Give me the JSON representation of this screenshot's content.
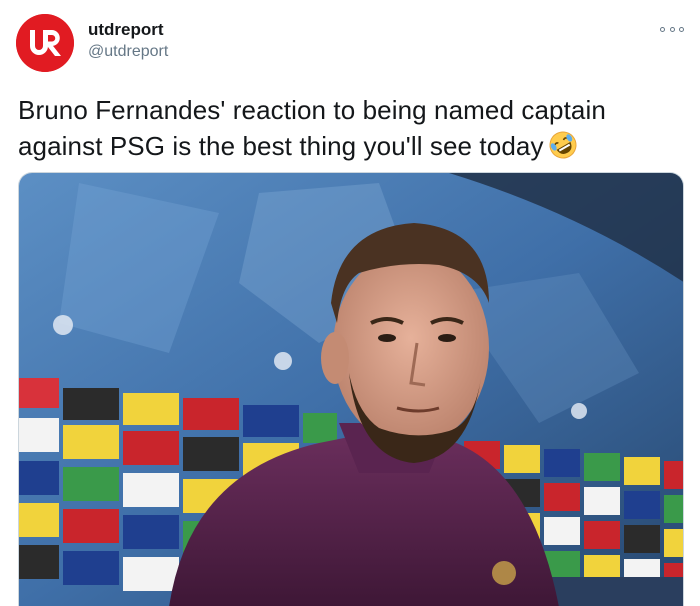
{
  "tweet": {
    "display_name": "utdreport",
    "handle": "@utdreport",
    "text": "Bruno Fernandes' reaction to being named captain against PSG is the best thing you'll see today",
    "emoji": "rolling-on-the-floor-laughing",
    "more_icon": "more-dots-icon"
  },
  "colors": {
    "brand_red": "#e11b22",
    "text": "#14171a",
    "secondary": "#657786"
  }
}
